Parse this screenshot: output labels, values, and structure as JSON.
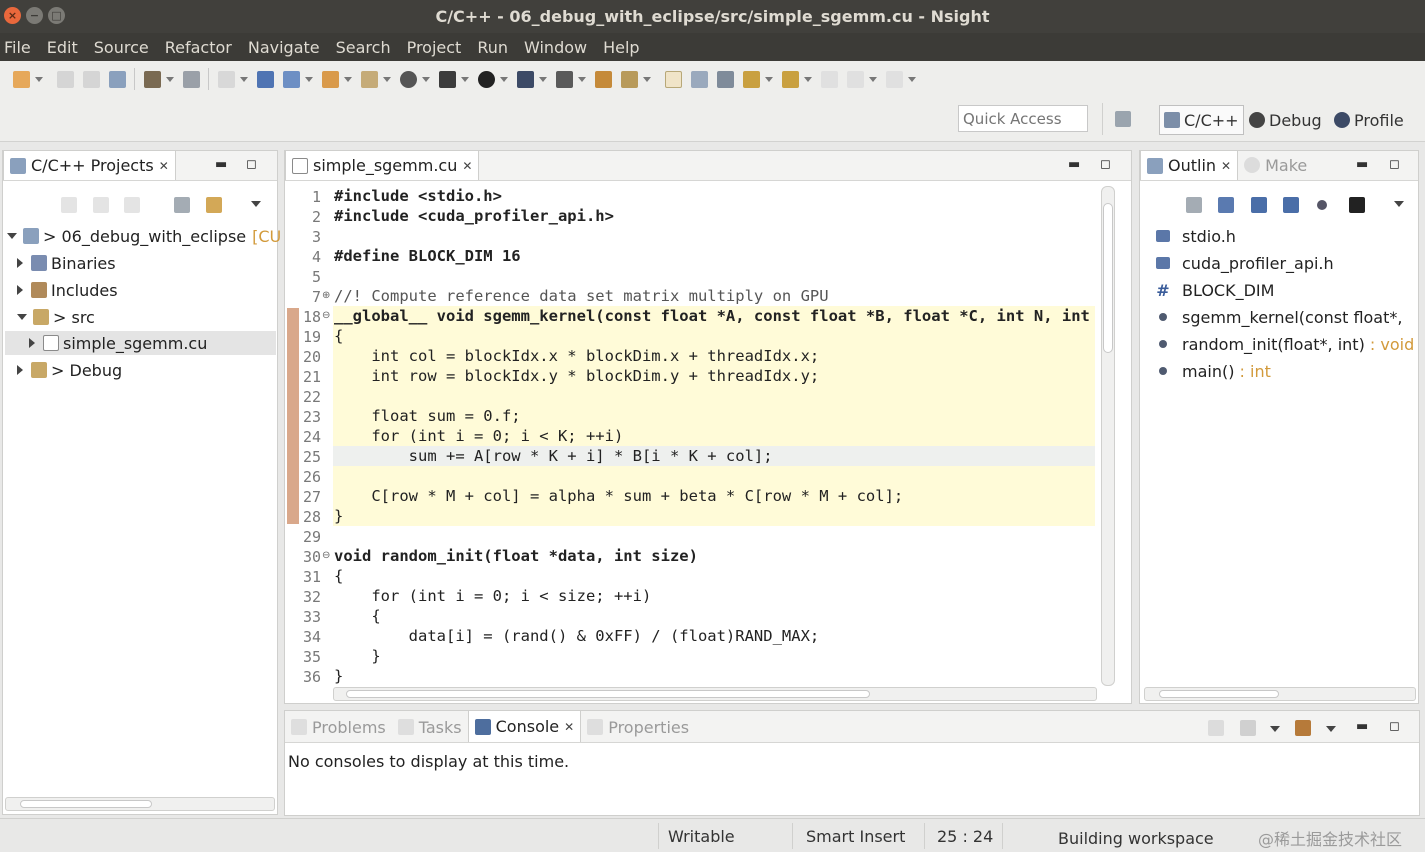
{
  "window": {
    "title": "C/C++ - 06_debug_with_eclipse/src/simple_sgemm.cu - Nsight",
    "controls": [
      "×",
      "−",
      "□"
    ]
  },
  "menu": [
    "File",
    "Edit",
    "Source",
    "Refactor",
    "Navigate",
    "Search",
    "Project",
    "Run",
    "Window",
    "Help"
  ],
  "toolbar": {
    "quick_access_placeholder": "Quick Access",
    "perspectives": [
      {
        "label": "C/C++",
        "icon": "cpp-perspective-icon"
      },
      {
        "label": "Debug",
        "icon": "bug-icon"
      },
      {
        "label": "Profile",
        "icon": "profile-icon"
      }
    ]
  },
  "project_explorer": {
    "tab_label": "C/C++ Projects",
    "tree": [
      {
        "label": "> 06_debug_with_eclipse",
        "suffix": "[CU",
        "indent": 0,
        "expanded": true
      },
      {
        "label": "Binaries",
        "indent": 1,
        "expanded": false
      },
      {
        "label": "Includes",
        "indent": 1,
        "expanded": false
      },
      {
        "label": "> src",
        "indent": 1,
        "expanded": true
      },
      {
        "label": "simple_sgemm.cu",
        "indent": 2,
        "expanded": false,
        "selected": true
      },
      {
        "label": "> Debug",
        "indent": 1,
        "expanded": false
      }
    ]
  },
  "editor": {
    "tab_label": "simple_sgemm.cu",
    "lines": [
      {
        "n": "1",
        "text": "#include <stdio.h>"
      },
      {
        "n": "2",
        "text": "#include <cuda_profiler_api.h>"
      },
      {
        "n": "3",
        "text": ""
      },
      {
        "n": "4",
        "text": "#define BLOCK_DIM 16"
      },
      {
        "n": "5",
        "text": ""
      },
      {
        "n": "7",
        "text": "//! Compute reference data set matrix multiply on GPU"
      },
      {
        "n": "18",
        "text": "__global__ void sgemm_kernel(const float *A, const float *B, float *C, int N, int"
      },
      {
        "n": "19",
        "text": "{"
      },
      {
        "n": "20",
        "text": "    int col = blockIdx.x * blockDim.x + threadIdx.x;"
      },
      {
        "n": "21",
        "text": "    int row = blockIdx.y * blockDim.y + threadIdx.y;"
      },
      {
        "n": "22",
        "text": ""
      },
      {
        "n": "23",
        "text": "    float sum = 0.f;"
      },
      {
        "n": "24",
        "text": "    for (int i = 0; i < K; ++i)"
      },
      {
        "n": "25",
        "text": "        sum += A[row * K + i] * B[i * K + col];"
      },
      {
        "n": "26",
        "text": ""
      },
      {
        "n": "27",
        "text": "    C[row * M + col] = alpha * sum + beta * C[row * M + col];"
      },
      {
        "n": "28",
        "text": "}"
      },
      {
        "n": "29",
        "text": ""
      },
      {
        "n": "30",
        "text": "void random_init(float *data, int size)"
      },
      {
        "n": "31",
        "text": "{"
      },
      {
        "n": "32",
        "text": "    for (int i = 0; i < size; ++i)"
      },
      {
        "n": "33",
        "text": "    {"
      },
      {
        "n": "34",
        "text": "        data[i] = (rand() & 0xFF) / (float)RAND_MAX;"
      },
      {
        "n": "35",
        "text": "    }"
      },
      {
        "n": "36",
        "text": "}"
      }
    ]
  },
  "outline": {
    "tab_label": "Outlin",
    "tab2_label": "Make",
    "items": [
      {
        "icon": "include-icon",
        "label": "stdio.h",
        "ret": ""
      },
      {
        "icon": "include-icon",
        "label": "cuda_profiler_api.h",
        "ret": ""
      },
      {
        "icon": "macro-icon",
        "label": "BLOCK_DIM",
        "ret": ""
      },
      {
        "icon": "function-icon",
        "label": "sgemm_kernel(const float*,",
        "ret": ""
      },
      {
        "icon": "function-icon",
        "label": "random_init(float*, int)",
        "ret": " : void"
      },
      {
        "icon": "function-icon",
        "label": "main()",
        "ret": " : int"
      }
    ]
  },
  "bottom_panel": {
    "tabs": [
      "Problems",
      "Tasks",
      "Console",
      "Properties"
    ],
    "active_tab": "Console",
    "message": "No consoles to display at this time."
  },
  "status": {
    "writable": "Writable",
    "insert_mode": "Smart Insert",
    "position": "25 : 24",
    "task": "Building workspace",
    "watermark": "@稀土掘金技术社区"
  },
  "colors": {
    "titlebar": "#41403c",
    "menubar": "#3c3b37",
    "highlight_line": "#fffbd8",
    "close_button": "#e9683c",
    "return_type": "#d29a3b"
  }
}
